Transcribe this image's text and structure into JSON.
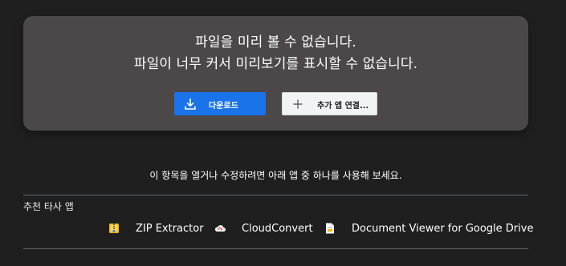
{
  "preview": {
    "message_line1": "파일을 미리 볼 수 없습니다.",
    "message_line2": "파일이 너무 커서 미리보기를 표시할 수 없습니다.",
    "download_label": "다운로드",
    "download_icon": "download-icon",
    "add_app_label": "추가 앱 연결...",
    "add_app_icon": "plus-icon"
  },
  "hint": "이 항목을 열거나 수정하려면 아래 앱 중 하나를 사용해 보세요.",
  "recommended": {
    "heading": "추천 타사 앱",
    "apps": [
      {
        "name": "ZIP Extractor",
        "icon": "zip-extractor-icon"
      },
      {
        "name": "CloudConvert",
        "icon": "cloudconvert-icon"
      },
      {
        "name": "Document Viewer for Google Drive",
        "icon": "document-viewer-icon"
      }
    ]
  },
  "colors": {
    "background": "#1f1f1f",
    "card": "#4c4749",
    "primary_button": "#1a73e8",
    "secondary_button": "#f1f3f4",
    "divider": "#5f6368"
  }
}
